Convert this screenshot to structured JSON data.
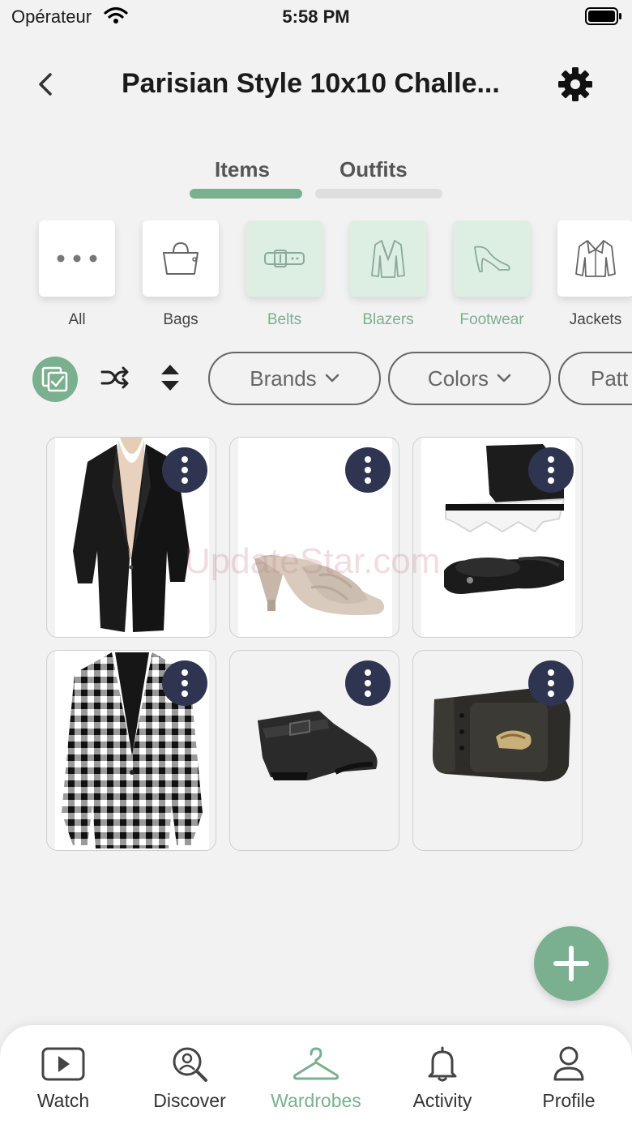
{
  "status_bar": {
    "carrier": "Opérateur",
    "time": "5:58 PM"
  },
  "header": {
    "title": "Parisian Style 10x10 Challe..."
  },
  "tabs": [
    {
      "label": "Items",
      "active": true
    },
    {
      "label": "Outfits",
      "active": false
    }
  ],
  "categories": [
    {
      "label": "All",
      "icon": "more-horizontal-icon",
      "selected": false
    },
    {
      "label": "Bags",
      "icon": "bag-icon",
      "selected": false
    },
    {
      "label": "Belts",
      "icon": "belt-icon",
      "selected": true
    },
    {
      "label": "Blazers",
      "icon": "blazer-icon",
      "selected": true
    },
    {
      "label": "Footwear",
      "icon": "high-heel-icon",
      "selected": true
    },
    {
      "label": "Jackets",
      "icon": "jacket-icon",
      "selected": false
    }
  ],
  "filters": {
    "brands": "Brands",
    "colors": "Colors",
    "patterns": "Patt"
  },
  "items": [
    {
      "name": "black-blazer"
    },
    {
      "name": "beige-mule-sandal"
    },
    {
      "name": "black-platform-sandal"
    },
    {
      "name": "gingham-blazer"
    },
    {
      "name": "black-wedge-bootie"
    },
    {
      "name": "black-buckle-belt"
    }
  ],
  "watermark": "UpdateStar.com",
  "bottom_nav": [
    {
      "label": "Watch",
      "icon": "play-icon",
      "active": false
    },
    {
      "label": "Discover",
      "icon": "discover-icon",
      "active": false
    },
    {
      "label": "Wardrobes",
      "icon": "hanger-icon",
      "active": true
    },
    {
      "label": "Activity",
      "icon": "bell-icon",
      "active": false
    },
    {
      "label": "Profile",
      "icon": "person-icon",
      "active": false
    }
  ],
  "colors": {
    "accent": "#7ab08f",
    "accent_light": "#ddefe2",
    "more_button": "#2f3550",
    "background": "#f2f2f2"
  }
}
